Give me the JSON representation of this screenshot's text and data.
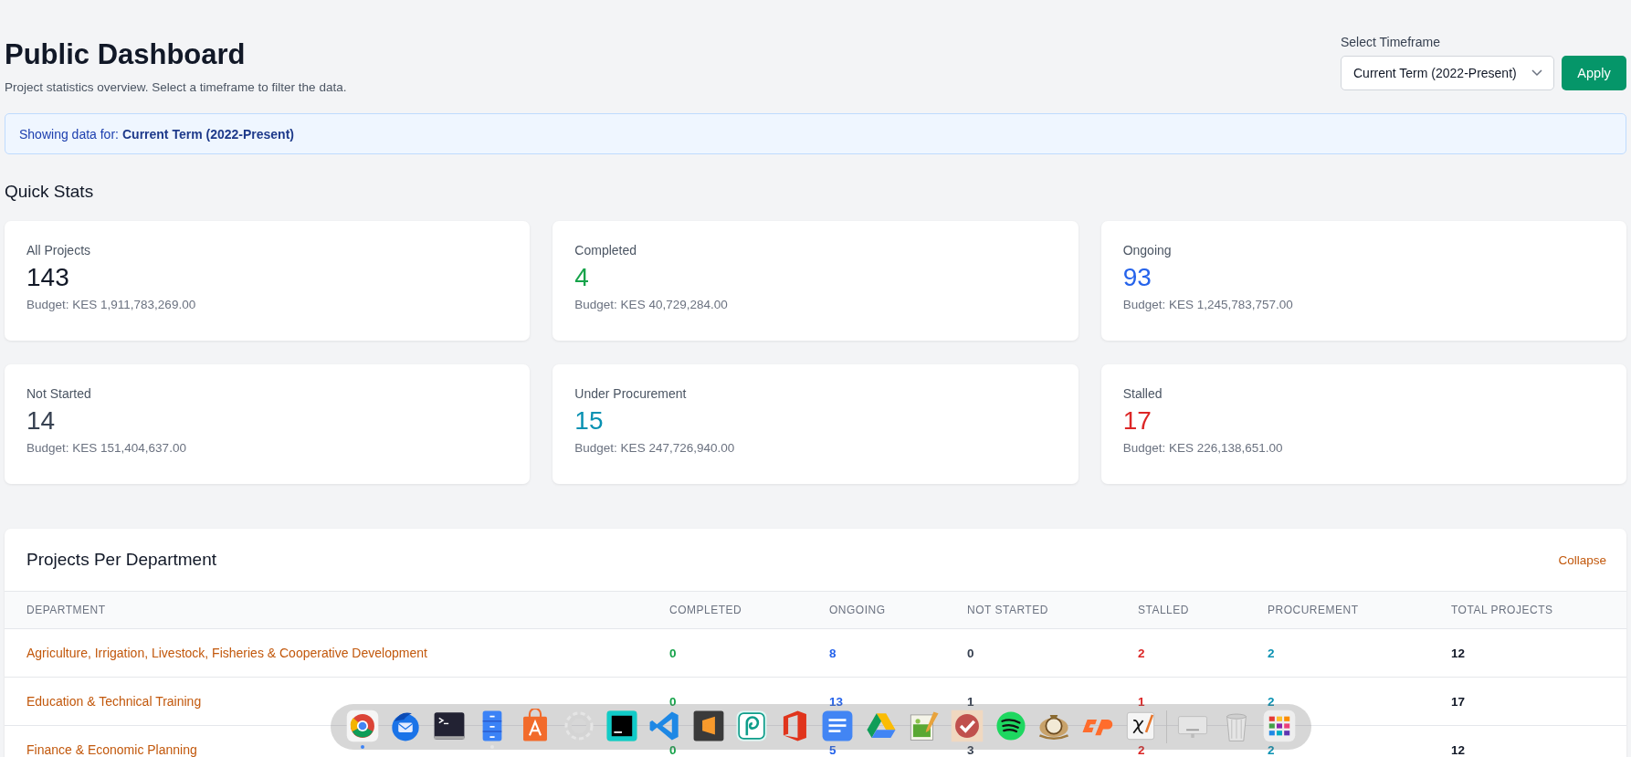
{
  "header": {
    "title": "Public Dashboard",
    "subtitle": "Project statistics overview. Select a timeframe to filter the data."
  },
  "timeframe": {
    "label": "Select Timeframe",
    "value": "Current Term (2022-Present)",
    "button": "Apply"
  },
  "banner": {
    "prefix": "Showing data for:",
    "value": "Current Term (2022-Present)"
  },
  "quick_stats": {
    "title": "Quick Stats",
    "cards": [
      {
        "kind": "all",
        "label": "All Projects",
        "value": "143",
        "budget": "Budget: KES 1,911,783,269.00"
      },
      {
        "kind": "completed",
        "label": "Completed",
        "value": "4",
        "budget": "Budget: KES 40,729,284.00"
      },
      {
        "kind": "ongoing",
        "label": "Ongoing",
        "value": "93",
        "budget": "Budget: KES 1,245,783,757.00"
      },
      {
        "kind": "not_started",
        "label": "Not Started",
        "value": "14",
        "budget": "Budget: KES 151,404,637.00"
      },
      {
        "kind": "procurement",
        "label": "Under Procurement",
        "value": "15",
        "budget": "Budget: KES 247,726,940.00"
      },
      {
        "kind": "stalled",
        "label": "Stalled",
        "value": "17",
        "budget": "Budget: KES 226,138,651.00"
      }
    ]
  },
  "departments": {
    "title": "Projects Per Department",
    "action": "Collapse",
    "columns": [
      {
        "kind": "name",
        "label": "DEPARTMENT"
      },
      {
        "kind": "completed",
        "label": "COMPLETED"
      },
      {
        "kind": "ongoing",
        "label": "ONGOING"
      },
      {
        "kind": "not_started",
        "label": "NOT STARTED"
      },
      {
        "kind": "stalled",
        "label": "STALLED"
      },
      {
        "kind": "procurement",
        "label": "PROCUREMENT"
      },
      {
        "kind": "total",
        "label": "TOTAL PROJECTS"
      }
    ],
    "rows": [
      [
        "Agriculture, Irrigation, Livestock, Fisheries & Cooperative Development",
        "0",
        "8",
        "0",
        "2",
        "2",
        "12"
      ],
      [
        "Education & Technical Training",
        "0",
        "13",
        "1",
        "1",
        "2",
        "17"
      ],
      [
        "Finance & Economic Planning",
        "0",
        "5",
        "3",
        "2",
        "2",
        "12"
      ]
    ]
  },
  "dock": {
    "apps": [
      {
        "running": true
      },
      {
        "running": false
      },
      {
        "running": false
      },
      {
        "running": true
      },
      {
        "running": false
      },
      {
        "running": false
      },
      {
        "running": false
      },
      {
        "running": false
      },
      {
        "running": false
      },
      {
        "running": false
      },
      {
        "running": false
      },
      {
        "running": false
      },
      {
        "running": false
      },
      {
        "running": false
      },
      {
        "running": false
      },
      {
        "running": false
      },
      {
        "running": false
      },
      {
        "running": false
      },
      {
        "running": false
      },
      {
        "running": false
      },
      {
        "running": false
      },
      {
        "running": false
      }
    ]
  }
}
